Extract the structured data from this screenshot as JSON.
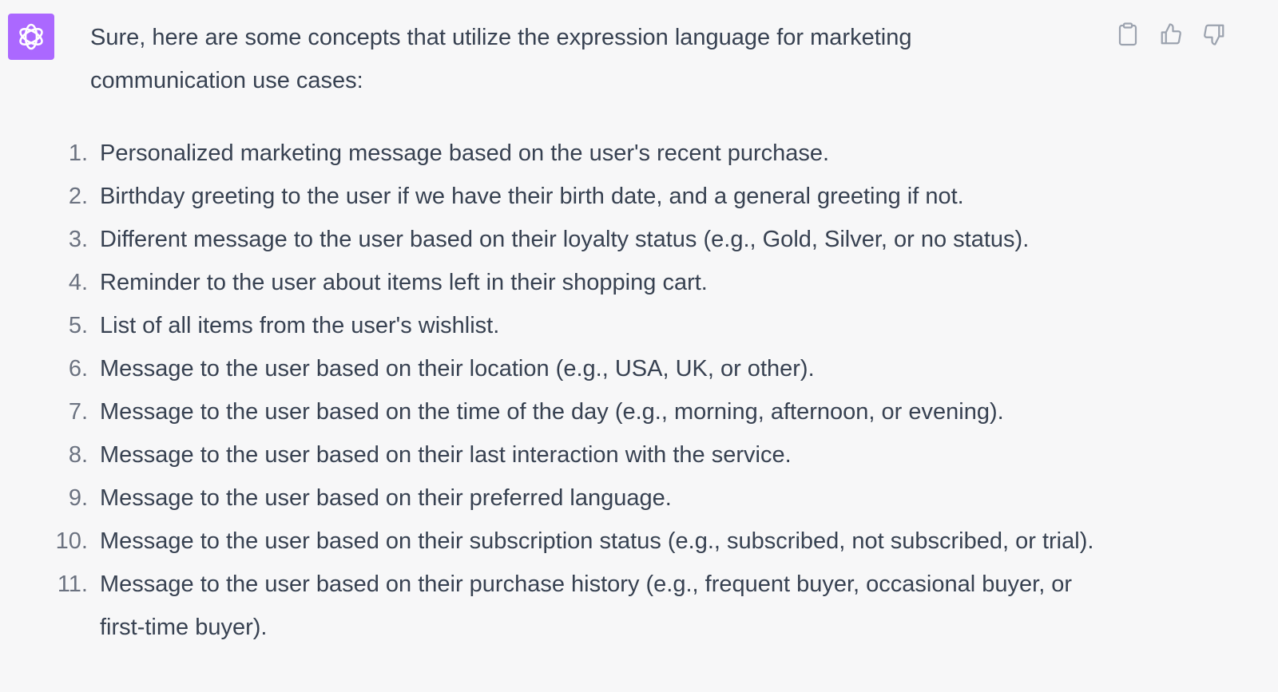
{
  "message": {
    "intro": "Sure, here are some concepts that utilize the expression language for marketing communication use cases:",
    "items": [
      {
        "num": "1.",
        "text": "Personalized marketing message based on the user's recent purchase."
      },
      {
        "num": "2.",
        "text": "Birthday greeting to the user if we have their birth date, and a general greeting if not."
      },
      {
        "num": "3.",
        "text": "Different message to the user based on their loyalty status (e.g., Gold, Silver, or no status)."
      },
      {
        "num": "4.",
        "text": "Reminder to the user about items left in their shopping cart."
      },
      {
        "num": "5.",
        "text": "List of all items from the user's wishlist."
      },
      {
        "num": "6.",
        "text": "Message to the user based on their location (e.g., USA, UK, or other)."
      },
      {
        "num": "7.",
        "text": "Message to the user based on the time of the day (e.g., morning, afternoon, or evening)."
      },
      {
        "num": "8.",
        "text": "Message to the user based on their last interaction with the service."
      },
      {
        "num": "9.",
        "text": "Message to the user based on their preferred language."
      },
      {
        "num": "10.",
        "text": "Message to the user based on their subscription status (e.g., subscribed, not subscribed, or trial)."
      },
      {
        "num": "11.",
        "text": "Message to the user based on their purchase history (e.g., frequent buyer, occasional buyer, or first-time buyer)."
      }
    ]
  },
  "avatar": {
    "icon": "openai-logo-icon",
    "color": "#ab68ff"
  },
  "actions": [
    {
      "icon": "clipboard-icon"
    },
    {
      "icon": "thumbs-up-icon"
    },
    {
      "icon": "thumbs-down-icon"
    }
  ]
}
